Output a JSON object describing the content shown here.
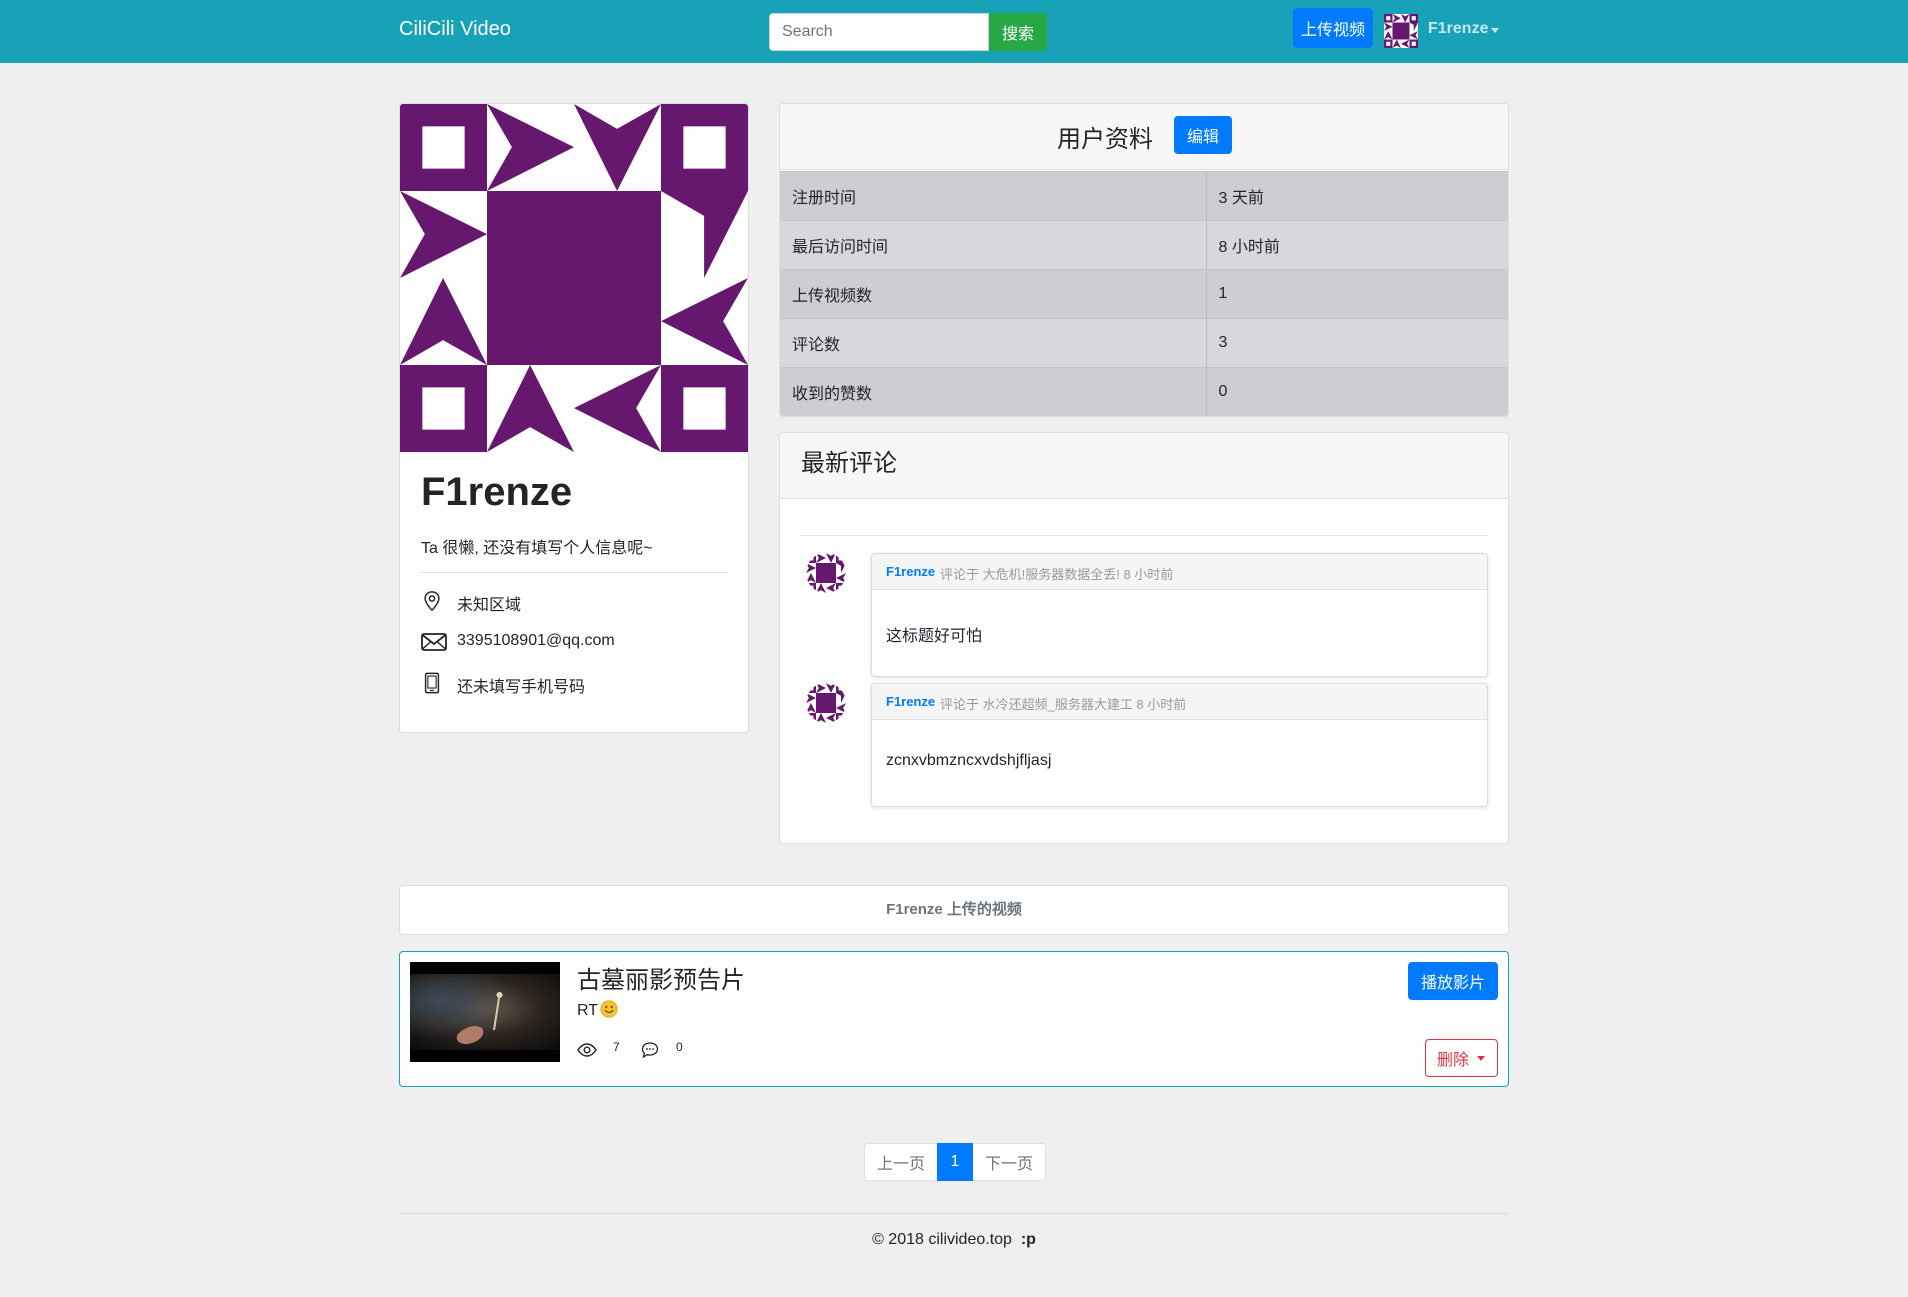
{
  "navbar": {
    "brand": "CiliCili Video",
    "search_placeholder": "Search",
    "search_button": "搜索",
    "upload_button": "上传视频",
    "username": "F1renze"
  },
  "profile": {
    "name": "F1renze",
    "bio": "Ta 很懒, 还没有填写个人信息呢~",
    "location": "未知区域",
    "email": "3395108901@qq.com",
    "phone": "还未填写手机号码",
    "avatar_color": "#66176e"
  },
  "stats": {
    "title": "用户资料",
    "edit_button": "编辑",
    "rows": [
      {
        "label": "注册时间",
        "value": "3 天前"
      },
      {
        "label": "最后访问时间",
        "value": "8 小时前"
      },
      {
        "label": "上传视频数",
        "value": "1"
      },
      {
        "label": "评论数",
        "value": "3"
      },
      {
        "label": "收到的赞数",
        "value": "0"
      }
    ]
  },
  "comments": {
    "title": "最新评论",
    "items": [
      {
        "user": "F1renze",
        "meta": "评论于  大危机!服务器数据全丢!   8 小时前",
        "body": "这标题好可怕"
      },
      {
        "user": "F1renze",
        "meta": "评论于  水冷还超频_服务器大建工   8 小时前",
        "body": "zcnxvbmzncxvdshjfljasj"
      }
    ]
  },
  "uploads": {
    "header": "F1renze 上传的视频",
    "videos": [
      {
        "title": "古墓丽影预告片",
        "desc": "RT",
        "views": "7",
        "comments": "0",
        "play_button": "播放影片",
        "delete_button": "删除"
      }
    ]
  },
  "pagination": {
    "prev": "上一页",
    "current": "1",
    "next": "下一页"
  },
  "footer": {
    "copyright": "© 2018  cilivideo.top",
    "suffix": ":p"
  }
}
